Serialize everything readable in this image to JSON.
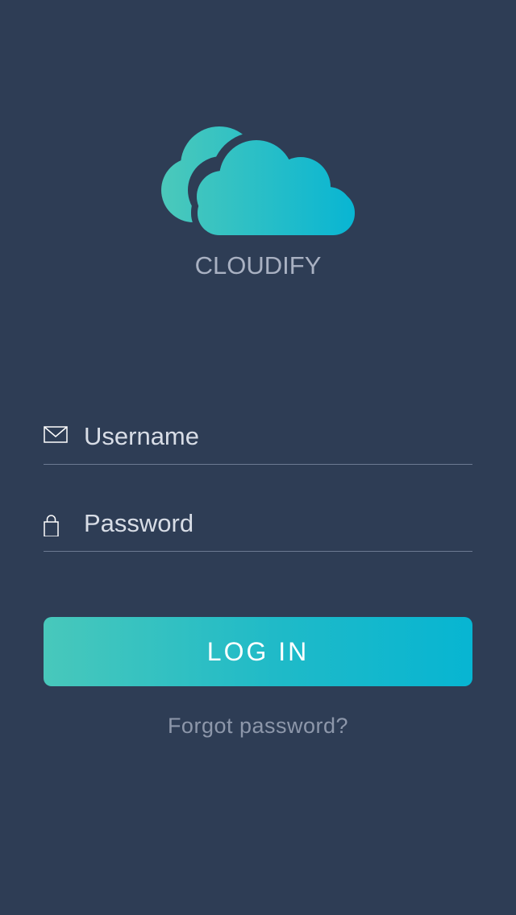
{
  "app": {
    "name": "CLOUDIFY",
    "logo_icon": "cloud-icon"
  },
  "login_form": {
    "username": {
      "placeholder": "Username",
      "value": "",
      "icon": "envelope-icon"
    },
    "password": {
      "placeholder": "Password",
      "value": "",
      "icon": "lock-icon"
    },
    "submit_label": "LOG IN",
    "forgot_password_label": "Forgot password?"
  },
  "colors": {
    "background": "#2e3d55",
    "accent_start": "#48c8bb",
    "accent_end": "#07b5d2",
    "muted_text": "#8d97aa"
  }
}
